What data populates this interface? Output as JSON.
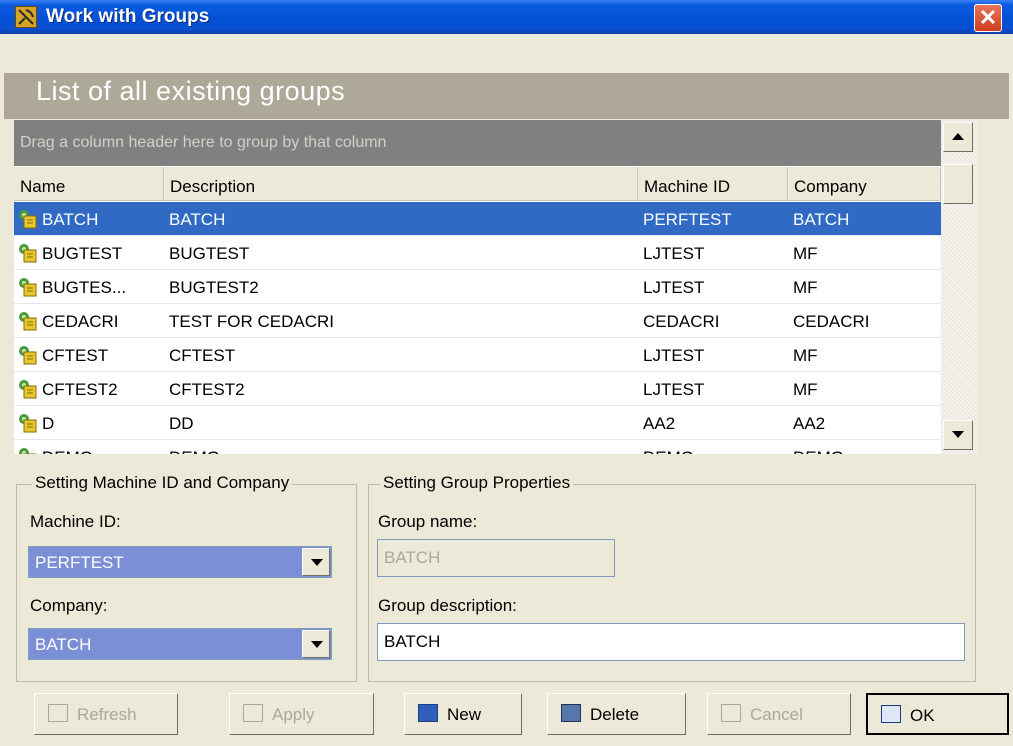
{
  "window": {
    "title": "Work with Groups"
  },
  "page": {
    "title": "List of all existing groups"
  },
  "grid": {
    "group_hint": "Drag a column header here to group by that column",
    "columns": [
      "Name",
      "Description",
      "Machine ID",
      "Company"
    ],
    "rows": [
      {
        "name": "BATCH",
        "description": "BATCH",
        "machine_id": "PERFTEST",
        "company": "BATCH",
        "selected": true
      },
      {
        "name": "BUGTEST",
        "description": "BUGTEST",
        "machine_id": "LJTEST",
        "company": "MF"
      },
      {
        "name": "BUGTES...",
        "description": "BUGTEST2",
        "machine_id": "LJTEST",
        "company": "MF"
      },
      {
        "name": "CEDACRI",
        "description": "TEST FOR CEDACRI",
        "machine_id": "CEDACRI",
        "company": "CEDACRI"
      },
      {
        "name": "CFTEST",
        "description": "CFTEST",
        "machine_id": "LJTEST",
        "company": "MF"
      },
      {
        "name": "CFTEST2",
        "description": "CFTEST2",
        "machine_id": "LJTEST",
        "company": "MF"
      },
      {
        "name": "D",
        "description": "DD",
        "machine_id": "AA2",
        "company": "AA2"
      },
      {
        "name": "DEMO",
        "description": "DEMO",
        "machine_id": "DEMO",
        "company": "DEMO"
      }
    ]
  },
  "machine_panel": {
    "legend": "Setting Machine ID and Company",
    "machine_label": "Machine ID:",
    "machine_value": "PERFTEST",
    "company_label": "Company:",
    "company_value": "BATCH"
  },
  "group_panel": {
    "legend": "Setting Group Properties",
    "name_label": "Group name:",
    "name_value": "BATCH",
    "desc_label": "Group description:",
    "desc_value": "BATCH"
  },
  "buttons": {
    "refresh": "Refresh",
    "apply": "Apply",
    "new": "New",
    "delete": "Delete",
    "cancel": "Cancel",
    "ok": "OK"
  },
  "colors": {
    "selection": "#316ac5",
    "titlebar": "#0450d4",
    "combo": "#7b8fd6"
  }
}
